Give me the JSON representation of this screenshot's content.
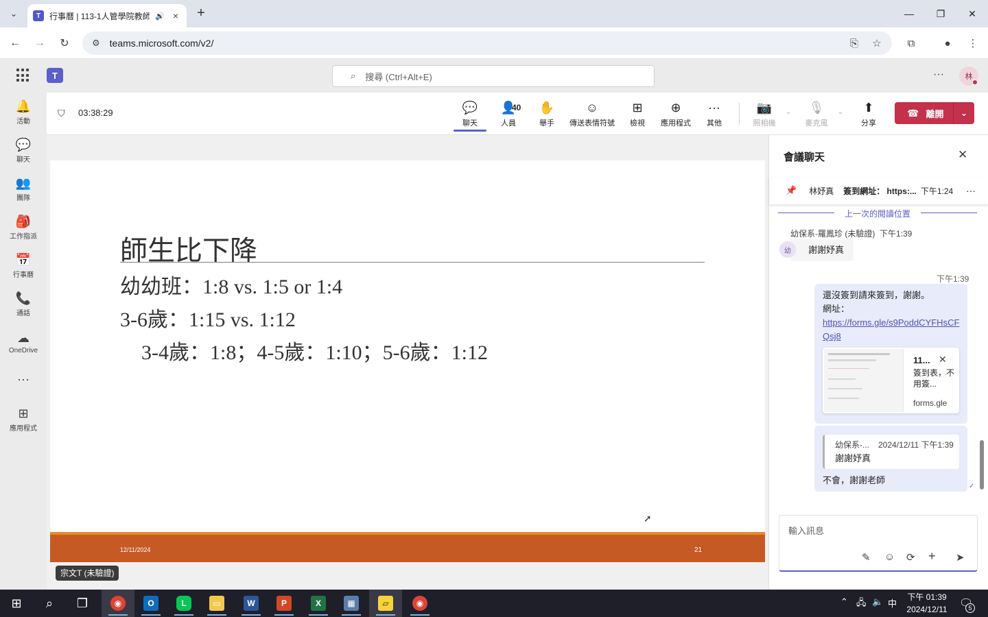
{
  "browser": {
    "tab_title": "行事曆 | 113-1人管學院教師",
    "tab_favicon": "T",
    "url": "teams.microsoft.com/v2/"
  },
  "teams": {
    "search_placeholder": "搜尋 (Ctrl+Alt+E)",
    "logo": "T",
    "avatar_initial": "林"
  },
  "rail": [
    {
      "label": "活動",
      "icon": "bell-icon",
      "glyph": "🔔"
    },
    {
      "label": "聊天",
      "icon": "chat-icon",
      "glyph": "💬"
    },
    {
      "label": "團隊",
      "icon": "teams-icon",
      "glyph": "👥"
    },
    {
      "label": "工作指派",
      "icon": "assignments-icon",
      "glyph": "🎒"
    },
    {
      "label": "行事曆",
      "icon": "calendar-icon",
      "glyph": "📅"
    },
    {
      "label": "通話",
      "icon": "phone-icon",
      "glyph": "📞"
    },
    {
      "label": "OneDrive",
      "icon": "cloud-icon",
      "glyph": "☁"
    },
    {
      "label": "",
      "icon": "more-icon",
      "glyph": "···"
    },
    {
      "label": "應用程式",
      "icon": "add-apps-icon",
      "glyph": "⊞"
    }
  ],
  "meeting": {
    "timer": "03:38:29",
    "toolbar": {
      "chat": "聊天",
      "people": "人員",
      "people_count": "40",
      "raise_hand": "舉手",
      "reactions": "傳送表情符號",
      "view": "檢視",
      "apps": "應用程式",
      "more": "其他",
      "camera": "照相機",
      "mic": "麥克風",
      "share": "分享",
      "leave": "離開"
    }
  },
  "slide": {
    "title": "師生比下降",
    "lines": [
      "幼幼班：1:8 vs. 1:5 or 1:4",
      "3-6歲：1:15 vs. 1:12",
      "3-4歲：1:8；4-5歲：1:10；5-6歲：1:12"
    ],
    "footer_date": "12/11/2024",
    "footer_page": "21",
    "presenter_tag": "宗文T (未驗證)"
  },
  "chat": {
    "title": "會議聊天",
    "pinned": {
      "sender": "林妤真",
      "text": "簽到網址： https:...",
      "time": "下午1:24"
    },
    "last_read": "上一次的閱讀位置",
    "msg1": {
      "sender": "幼保系-羅鳳珍 (未驗證)",
      "time": "下午1:39",
      "avatar": "幼",
      "text": "謝謝妤真"
    },
    "msg2": {
      "time": "下午1:39",
      "line1": "還沒簽到請來簽到，謝謝。",
      "line2": "網址：",
      "link": "https://forms.gle/s9PoddCYFHsCFQsj8",
      "card_title": "11...",
      "card_desc": "簽到表，不用簽...",
      "card_domain": "forms.gle"
    },
    "msg3": {
      "quote_sender": "幼保系-...",
      "quote_time": "2024/12/11 下午1:39",
      "quote_text": "謝謝妤真",
      "text": "不會，謝謝老師"
    },
    "compose_placeholder": "輸入訊息"
  },
  "taskbar": {
    "time": "下午 01:39",
    "date": "2024/12/11",
    "ime": "中",
    "notifications": "5"
  }
}
